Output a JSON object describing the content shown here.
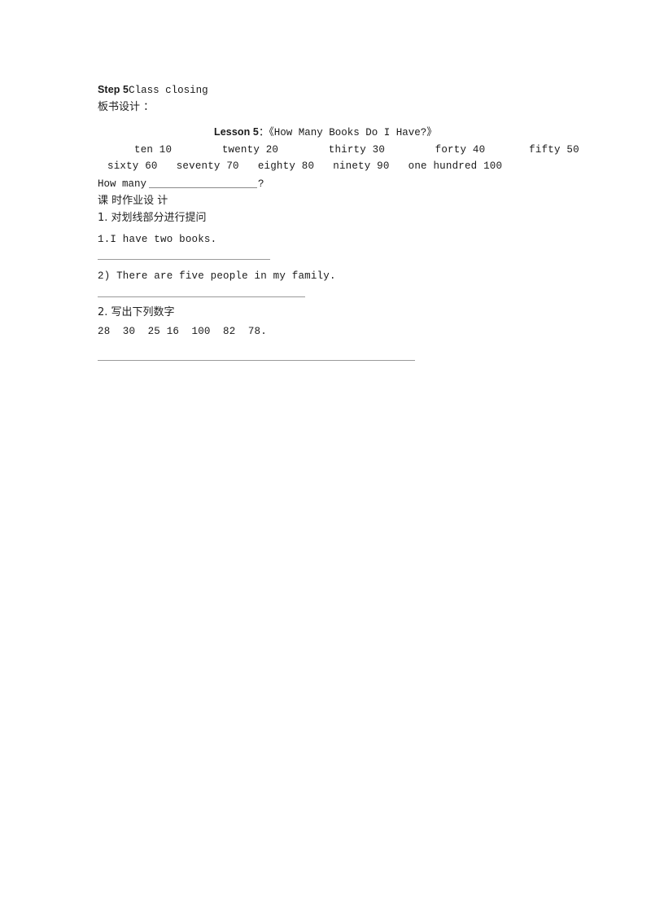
{
  "document": {
    "page_background": "#ffffff",
    "text_color": "#262626",
    "rule_color": "#9a9a9a"
  },
  "step_heading": {
    "bold_part": "Step 5",
    "regular_part": "Class closing"
  },
  "blackboard_design": {
    "label": "板书设计 ："
  },
  "lesson_title": {
    "bold_part": "Lesson 5",
    "regular_part": "：《How Many Books Do I Have?》"
  },
  "number_words": {
    "row1": "ten 10        twenty 20        thirty 30        forty 40       fifty 50",
    "row2": "sixty 60   seventy 70   eighty 80   ninety 90   one hundred 100",
    "items": [
      {
        "word": "ten",
        "value": "10"
      },
      {
        "word": "twenty",
        "value": "20"
      },
      {
        "word": "thirty",
        "value": "30"
      },
      {
        "word": "forty",
        "value": "40"
      },
      {
        "word": "fifty",
        "value": "50"
      },
      {
        "word": "sixty",
        "value": "60"
      },
      {
        "word": "seventy",
        "value": "70"
      },
      {
        "word": "eighty",
        "value": "80"
      },
      {
        "word": "ninety",
        "value": "90"
      },
      {
        "word": "one hundred",
        "value": "100"
      }
    ]
  },
  "how_many_prompt": {
    "prefix": "How many",
    "suffix": "?"
  },
  "homework": {
    "heading": "课 时作业设 计",
    "task1": {
      "title": "1. 对划线部分进行提问",
      "item1": "1.I have two books.",
      "item2": "2) There are five people in my family."
    },
    "task2": {
      "title": "2. 写出下列数字",
      "numbers": "28  30  25 16  100  82  78."
    }
  }
}
